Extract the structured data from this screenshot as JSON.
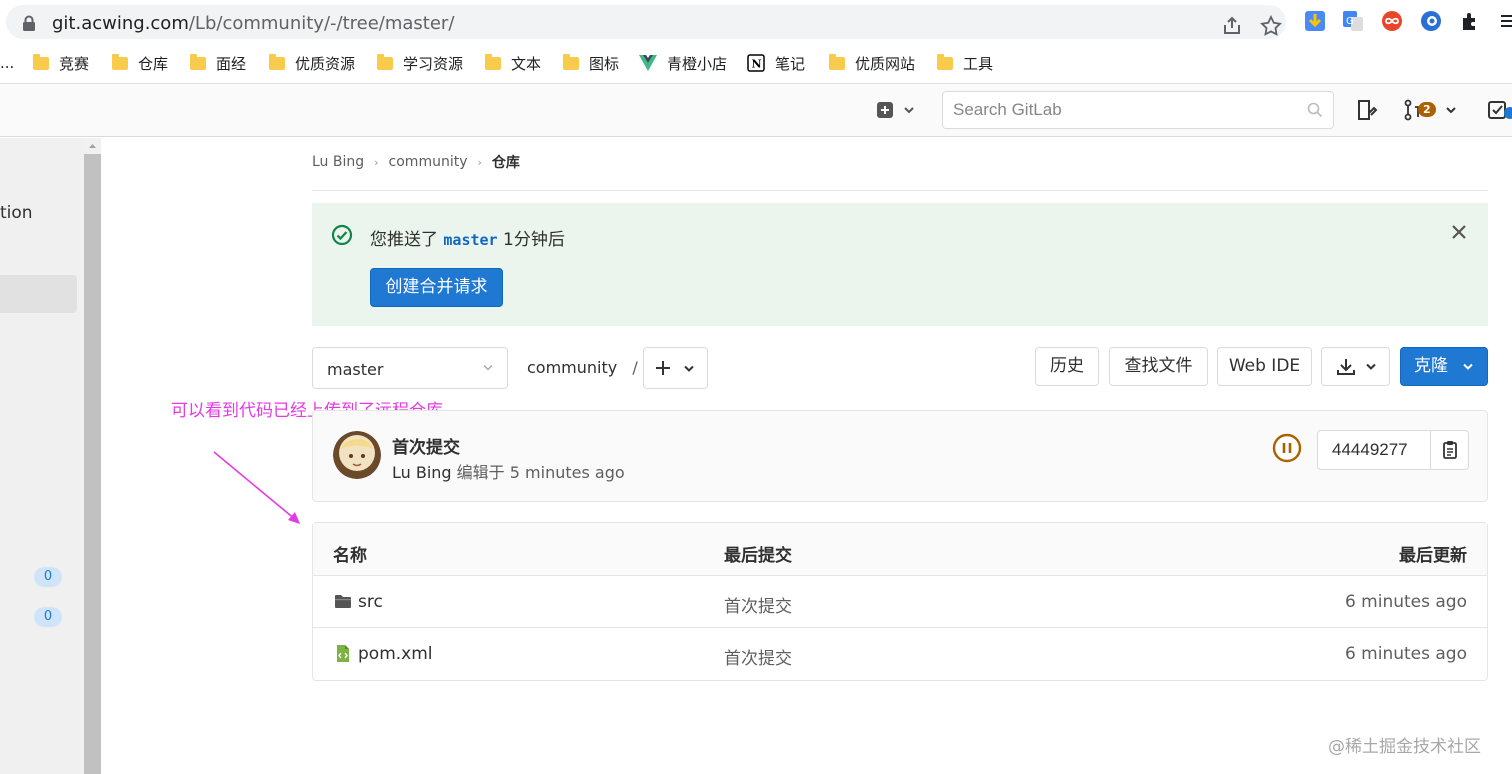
{
  "browser": {
    "url_host": "git.acwing.com",
    "url_path": "/Lb/community/-/tree/master/",
    "bookmarks": [
      {
        "label": "...",
        "type": "overflow"
      },
      {
        "label": "竞赛",
        "type": "folder"
      },
      {
        "label": "仓库",
        "type": "folder"
      },
      {
        "label": "面经",
        "type": "folder"
      },
      {
        "label": "优质资源",
        "type": "folder"
      },
      {
        "label": "学习资源",
        "type": "folder"
      },
      {
        "label": "文本",
        "type": "folder"
      },
      {
        "label": "图标",
        "type": "folder"
      },
      {
        "label": "青橙小店",
        "type": "vue"
      },
      {
        "label": "笔记",
        "type": "notion"
      },
      {
        "label": "优质网站",
        "type": "folder"
      },
      {
        "label": "工具",
        "type": "folder"
      }
    ]
  },
  "header": {
    "search_placeholder": "Search GitLab",
    "mr_count": "2"
  },
  "sidebar": {
    "partial_label": "tion",
    "badge_1": "0",
    "badge_2": "0"
  },
  "breadcrumb": {
    "owner": "Lu Bing",
    "project": "community",
    "current": "仓库"
  },
  "alert": {
    "prefix": "您推送了",
    "branch": "master",
    "suffix": "1分钟后",
    "button": "创建合并请求"
  },
  "repo_nav": {
    "branch": "master",
    "path": "community",
    "path_sep": "/",
    "history": "历史",
    "find_file": "查找文件",
    "web_ide": "Web IDE",
    "clone": "克隆"
  },
  "annotation": "可以看到代码已经上传到了远程仓库",
  "last_commit": {
    "title": "首次提交",
    "author": "Lu Bing",
    "action": "编辑于",
    "time": "5 minutes ago",
    "sha": "44449277"
  },
  "tree": {
    "columns": [
      "名称",
      "最后提交",
      "最后更新"
    ],
    "rows": [
      {
        "name": "src",
        "icon": "folder-icon",
        "commit": "首次提交",
        "updated": "6 minutes ago"
      },
      {
        "name": "pom.xml",
        "icon": "xml-file-icon",
        "commit": "首次提交",
        "updated": "6 minutes ago"
      }
    ]
  },
  "watermark": "@稀土掘金技术社区",
  "colors": {
    "primary": "#1f78d1",
    "alert_bg": "#ecf4ee",
    "success": "#108548",
    "annotation": "#e33be3",
    "pipeline_running": "#ab6100"
  }
}
